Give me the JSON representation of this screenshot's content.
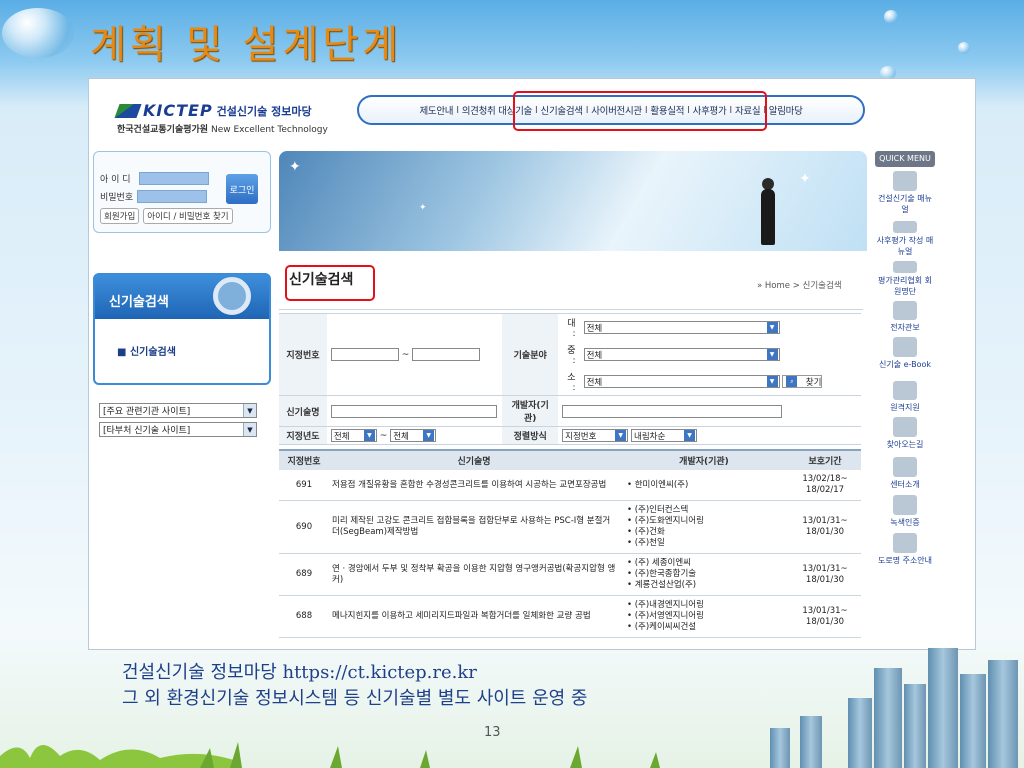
{
  "slide": {
    "title": "계획 및 설계단계",
    "bottom_line1": "건설신기술 정보마당  https://ct.kictep.re.kr",
    "bottom_line2": "그 외 환경신기술 정보시스템 등 신기술별 별도 사이트 운영 중",
    "page_number": "13"
  },
  "site": {
    "logo_brand": "KICTEP",
    "logo_sub": "건설신기술 정보마당",
    "org_name": "한국건설교통기술평가원",
    "org_tagline": "New Excellent Technology",
    "nav": [
      "제도안내",
      "의견청취 대상기술",
      "신기술검색",
      "사이버전시관",
      "활용실적",
      "사후평가",
      "자료실",
      "알림마당"
    ],
    "nav_sep": "I"
  },
  "login": {
    "id_label": "아 이 디",
    "pw_label": "비밀번호",
    "login_button": "로그인",
    "join_link": "회원가입",
    "find_link": "아이디 / 비밀번호 찾기"
  },
  "sidebar": {
    "title": "신기술검색",
    "menu_item": "신기술검색",
    "select1": "[주요 관련기관 사이트]",
    "select2": "[타부처 신기술 사이트]"
  },
  "quick_menu": {
    "title": "QUICK MENU",
    "items": [
      "건설신기술 매뉴얼",
      "사후평가 작성 매뉴얼",
      "평가관리협회 회원명단",
      "전자관보",
      "신기술 e-Book",
      "원격지원",
      "찾아오는길",
      "센터소개",
      "녹색인증",
      "도로명 주소안내"
    ]
  },
  "page": {
    "title": "신기술검색",
    "breadcrumb": "» Home > 신기술검색"
  },
  "search_form": {
    "designation_label": "지정번호",
    "range_sep": "~",
    "field_label": "기술분야",
    "large_label": "대 :",
    "mid_label": "중 :",
    "small_label": "소 :",
    "all": "전체",
    "find_button": "찾기",
    "tech_name_label": "신기술명",
    "developer_label": "개발자(기관)",
    "year_label": "지정년도",
    "sort_label": "정렬방식",
    "sort_field": "지정번호",
    "sort_order": "내림차순"
  },
  "results": {
    "headers": [
      "지정번호",
      "신기술명",
      "개발자(기관)",
      "보호기간"
    ],
    "rows": [
      {
        "no": "691",
        "name": "저용점 개질유황을 혼합한 수경성콘크리트를 이용하여 시공하는 교면포장공법",
        "devs": [
          "한미이엔씨(주)"
        ],
        "period1": "13/02/18~",
        "period2": "18/02/17"
      },
      {
        "no": "690",
        "name": "미리 제작된 고강도 콘크리트 접합블록을 접합단부로 사용하는 PSC-I형 분절거더(SegBeam)제작방법",
        "devs": [
          "(주)인터컨스텍",
          "(주)도화엔지니어링",
          "(주)건화",
          "(주)천일"
        ],
        "period1": "13/01/31~",
        "period2": "18/01/30"
      },
      {
        "no": "689",
        "name": "연 · 경암에서 두부 및 정착부 확공을 이용한 지압형 영구앵커공법(확공지압형 앵커)",
        "devs": [
          "(주) 세종이엔씨",
          "(주)한국종합기술",
          "계룡건설산업(주)"
        ],
        "period1": "13/01/31~",
        "period2": "18/01/30"
      },
      {
        "no": "688",
        "name": "메나지힌지를 이용하고 세미리지드파일과 복합거더를 일체화한 교량 공법",
        "devs": [
          "(주)내경엔지니어링",
          "(주)서영엔지니어링",
          "(주)케이씨씨건설"
        ],
        "period1": "13/01/31~",
        "period2": "18/01/30"
      }
    ]
  },
  "colors": {
    "title_orange": "#e58a16",
    "highlight_red": "#e3101a",
    "nav_blue": "#2f6fc0",
    "text_navy": "#1e3f8a"
  }
}
